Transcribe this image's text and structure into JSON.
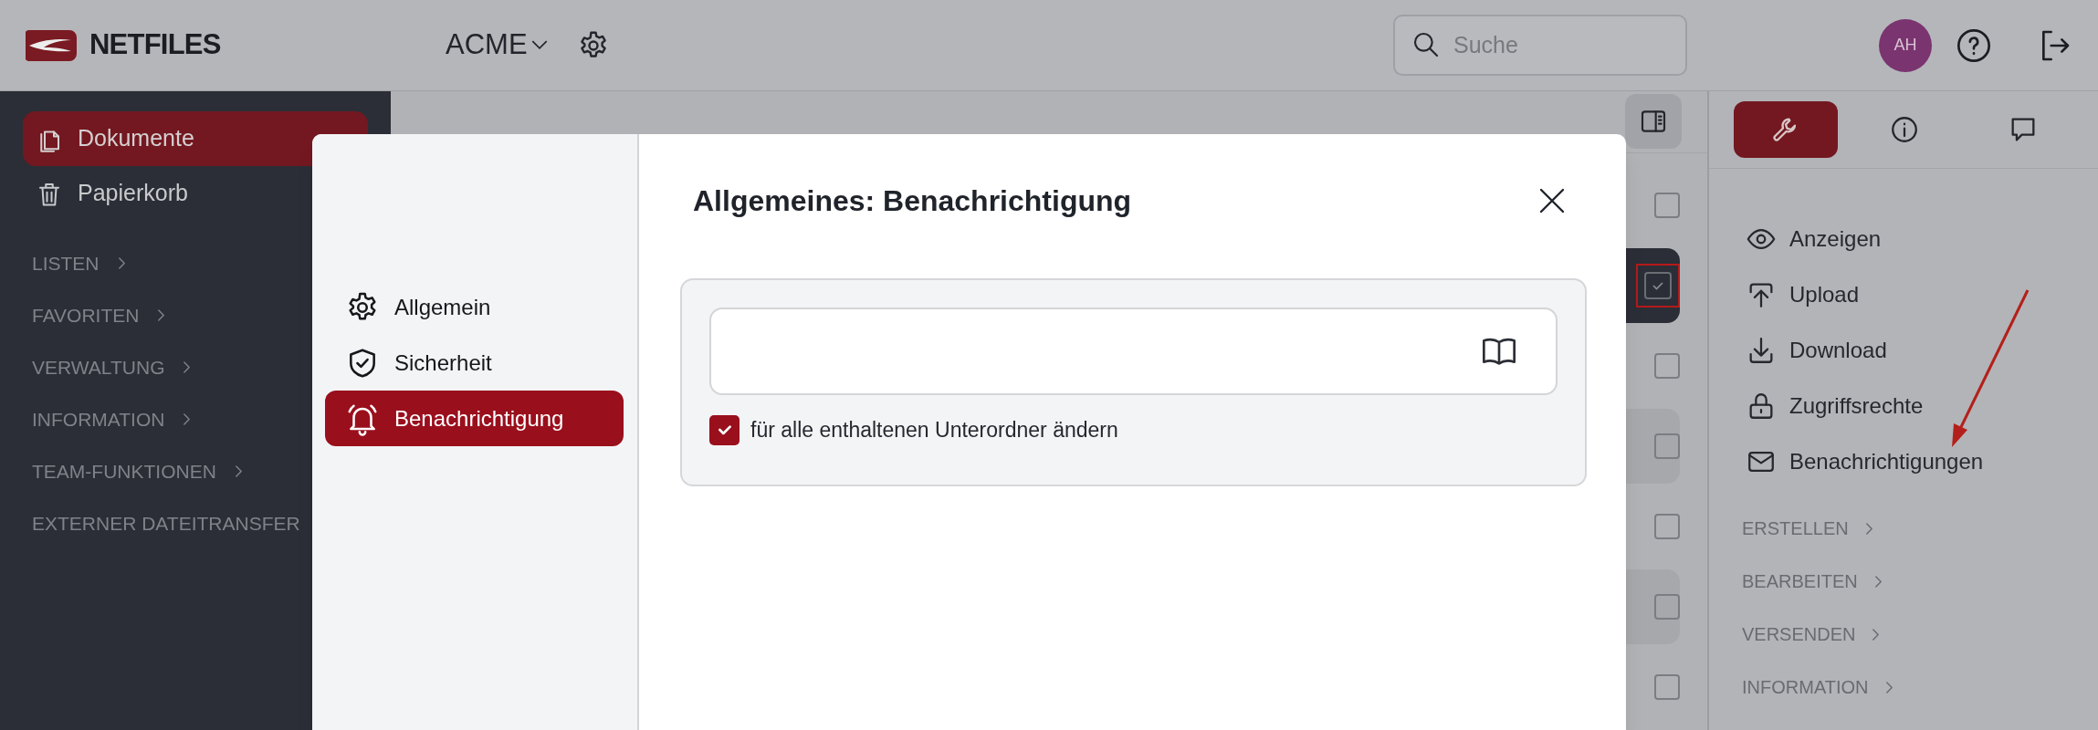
{
  "header": {
    "logo": "NETFILES",
    "workspace": "ACME",
    "search": {
      "placeholder": "Suche"
    },
    "avatar": "AH"
  },
  "sidebar": {
    "items": [
      {
        "label": "Dokumente",
        "selected": true
      },
      {
        "label": "Papierkorb",
        "selected": false
      }
    ],
    "sections": [
      {
        "label": "LISTEN"
      },
      {
        "label": "FAVORITEN"
      },
      {
        "label": "VERWALTUNG"
      },
      {
        "label": "INFORMATION"
      },
      {
        "label": "TEAM-FUNKTIONEN"
      },
      {
        "label": "EXTERNER DATEITRANSFER"
      }
    ]
  },
  "list_rows": [
    {
      "checked": false,
      "kind": "plain"
    },
    {
      "checked": true,
      "kind": "active"
    },
    {
      "checked": false,
      "kind": "plain"
    },
    {
      "checked": false,
      "kind": "shaded"
    },
    {
      "checked": false,
      "kind": "plain"
    },
    {
      "checked": false,
      "kind": "shaded"
    },
    {
      "checked": false,
      "kind": "plain"
    }
  ],
  "right_panel": {
    "tabs": [
      {
        "selected": true
      },
      {
        "selected": false
      },
      {
        "selected": false
      }
    ],
    "actions": [
      {
        "label": "Anzeigen"
      },
      {
        "label": "Upload"
      },
      {
        "label": "Download"
      },
      {
        "label": "Zugriffsrechte"
      },
      {
        "label": "Benachrichtigungen"
      }
    ],
    "sections": [
      {
        "label": "ERSTELLEN"
      },
      {
        "label": "BEARBEITEN"
      },
      {
        "label": "VERSENDEN"
      },
      {
        "label": "INFORMATION"
      }
    ]
  },
  "modal": {
    "nav": [
      {
        "label": "Allgemein",
        "selected": false
      },
      {
        "label": "Sicherheit",
        "selected": false
      },
      {
        "label": "Benachrichtigung",
        "selected": true
      }
    ],
    "title": "Allgemeines: Benachrichtigung",
    "checkbox": {
      "label": "für alle enthaltenen Unterordner ändern",
      "checked": true
    }
  }
}
